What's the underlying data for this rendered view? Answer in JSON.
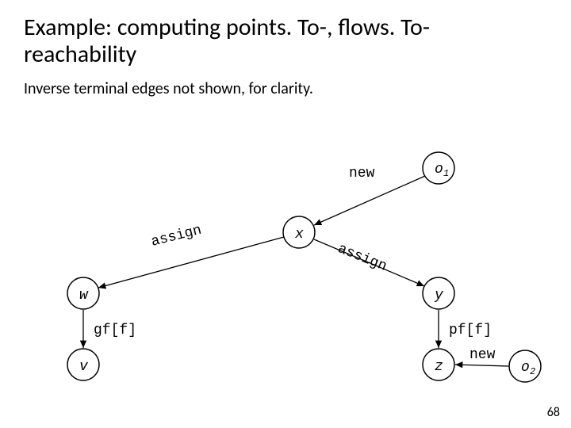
{
  "title": "Example: computing points. To-, flows. To-reachability",
  "subtitle": "Inverse terminal edges not shown, for clarity.",
  "page_number": "68",
  "diagram": {
    "nodes": {
      "o1": {
        "label": "o",
        "sub": "1"
      },
      "o2": {
        "label": "o",
        "sub": "2"
      },
      "x": {
        "label": "x"
      },
      "y": {
        "label": "y"
      },
      "z": {
        "label": "z"
      },
      "w": {
        "label": "w"
      },
      "v": {
        "label": "v"
      }
    },
    "edges": {
      "o1_x": "new",
      "o2_z": "new",
      "x_w": "assign",
      "x_y": "assign",
      "w_v": "gf[f]",
      "y_z": "pf[f]"
    }
  }
}
